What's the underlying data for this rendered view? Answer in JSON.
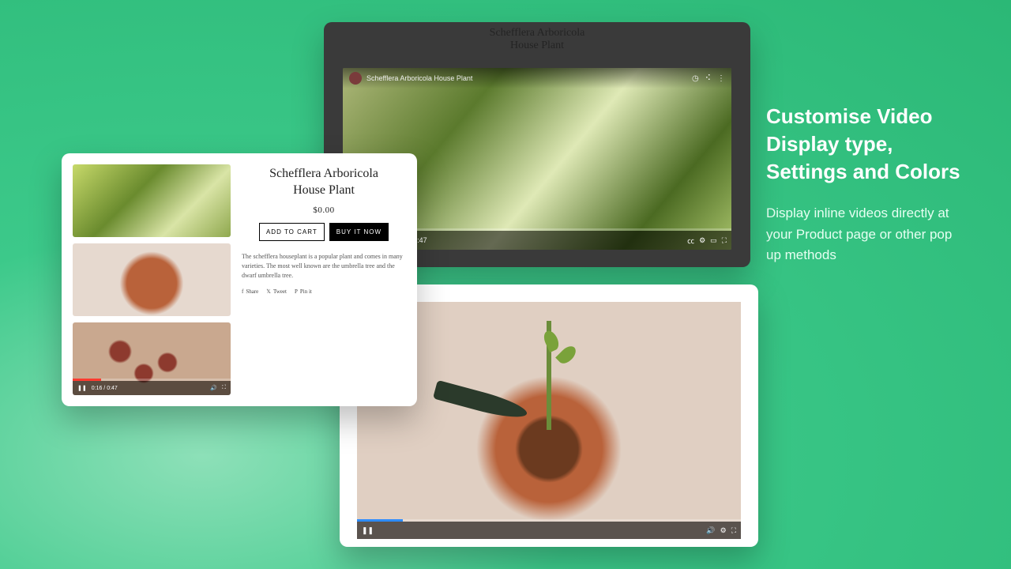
{
  "copy": {
    "heading": "Customise Video Display type, Settings and Colors",
    "body": "Display inline videos directly at your Product page or other pop up methods"
  },
  "product": {
    "title_line1": "Schefflera Arboricola",
    "title_line2": "House Plant",
    "price": "$0.00",
    "add_to_cart": "ADD TO CART",
    "buy_now": "BUY IT NOW",
    "description": "The schefflera houseplant is a popular plant and comes in many varieties. The most well known are the umbrella tree and the dwarf umbrella tree.",
    "share": "Share",
    "tweet": "Tweet",
    "pin": "Pin it",
    "thumb_time": "0:16 / 0:47"
  },
  "dark": {
    "header_line1": "Schefflera Arboricola",
    "header_line2": "House Plant",
    "video_title": "Schefflera Arboricola House Plant",
    "time": "0:01 / 0:47"
  },
  "inline": {
    "play_state": "❚❚"
  }
}
